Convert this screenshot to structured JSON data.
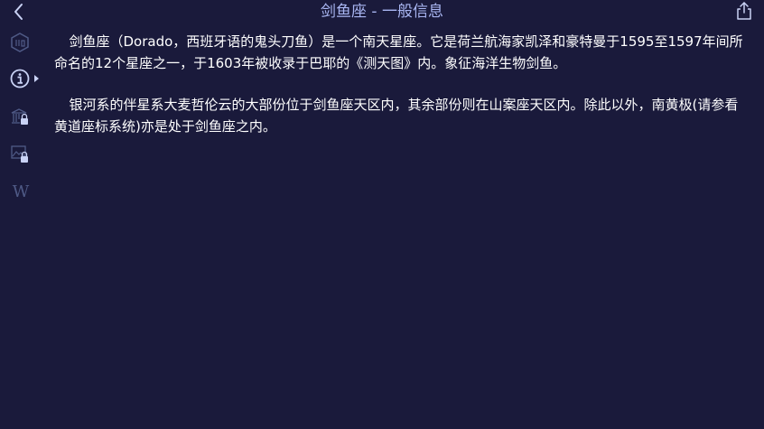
{
  "header": {
    "title": "剑鱼座 - 一般信息",
    "back_icon": "chevron-left-icon",
    "share_icon": "share-icon"
  },
  "sidebar": {
    "items": [
      {
        "name": "constellation-map",
        "icon": "constellation-icon"
      },
      {
        "name": "general-info",
        "icon": "info-icon",
        "active": true
      },
      {
        "name": "mythology",
        "icon": "locked-temple-icon",
        "locked": true
      },
      {
        "name": "gallery",
        "icon": "locked-image-icon",
        "locked": true
      },
      {
        "name": "wikipedia",
        "icon": "wikipedia-icon",
        "glyph": "W"
      }
    ]
  },
  "content": {
    "paragraphs": [
      "剑鱼座（Dorado，西班牙语的鬼头刀鱼）是一个南天星座。它是荷兰航海家凯泽和豪特曼于1595至1597年间所命名的12个星座之一，于1603年被收录于巴耶的《测天图》内。象征海洋生物剑鱼。",
      "银河系的伴星系大麦哲伦云的大部份位于剑鱼座天区内，其余部份则在山案座天区内。除此以外，南黄极(请参看黄道座标系统)亦是处于剑鱼座之内。"
    ]
  },
  "colors": {
    "background": "#1a1a3b",
    "title": "#a9b6f2",
    "icon_active": "#c9d2f5",
    "icon_inactive": "#4f5a86"
  }
}
